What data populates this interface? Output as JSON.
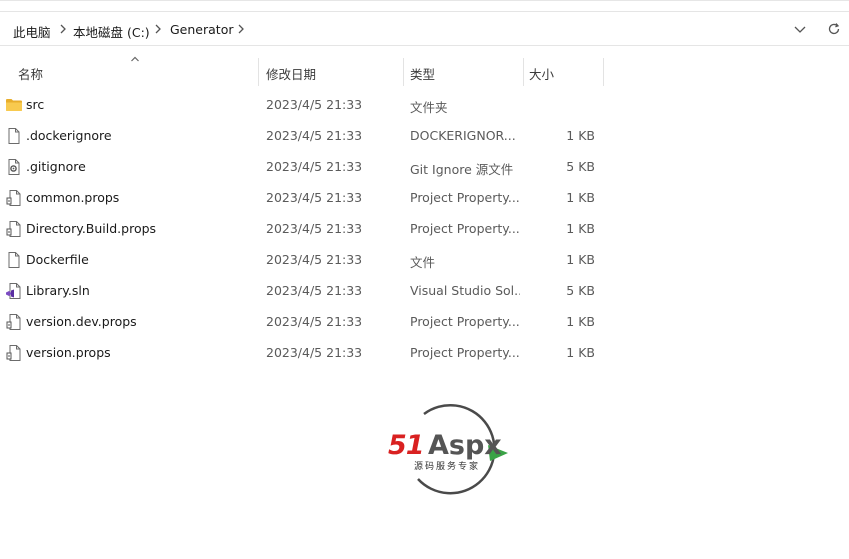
{
  "address_bar": {
    "breadcrumbs": [
      "此电脑",
      "本地磁盘 (C:)",
      "Generator"
    ],
    "dropdown_icon": "chevron-down-icon",
    "refresh_icon": "refresh-icon"
  },
  "columns": {
    "name": "名称",
    "date": "修改日期",
    "type": "类型",
    "size": "大小",
    "sort_indicator": "sort-ascending-icon"
  },
  "files": [
    {
      "name": "src",
      "date": "2023/4/5 21:33",
      "type": "文件夹",
      "size": "",
      "icon": "folder-icon"
    },
    {
      "name": ".dockerignore",
      "date": "2023/4/5 21:33",
      "type": "DOCKERIGNOR...",
      "size": "1 KB",
      "icon": "file-icon"
    },
    {
      "name": ".gitignore",
      "date": "2023/4/5 21:33",
      "type": "Git Ignore 源文件",
      "size": "5 KB",
      "icon": "gear-file-icon"
    },
    {
      "name": "common.props",
      "date": "2023/4/5 21:33",
      "type": "Project Property...",
      "size": "1 KB",
      "icon": "props-file-icon"
    },
    {
      "name": "Directory.Build.props",
      "date": "2023/4/5 21:33",
      "type": "Project Property...",
      "size": "1 KB",
      "icon": "props-file-icon"
    },
    {
      "name": "Dockerfile",
      "date": "2023/4/5 21:33",
      "type": "文件",
      "size": "1 KB",
      "icon": "file-icon"
    },
    {
      "name": "Library.sln",
      "date": "2023/4/5 21:33",
      "type": "Visual Studio Sol...",
      "size": "5 KB",
      "icon": "visual-studio-icon"
    },
    {
      "name": "version.dev.props",
      "date": "2023/4/5 21:33",
      "type": "Project Property...",
      "size": "1 KB",
      "icon": "props-file-icon"
    },
    {
      "name": "version.props",
      "date": "2023/4/5 21:33",
      "type": "Project Property...",
      "size": "1 KB",
      "icon": "props-file-icon"
    }
  ],
  "watermark": {
    "brand_number": "51",
    "brand_text": "Aspx",
    "tagline": "源码服务专家"
  },
  "colors": {
    "folder": "#f5c342",
    "accent_red": "#d92121",
    "accent_green": "#3aa346",
    "text_secondary": "#5a5a5a"
  }
}
